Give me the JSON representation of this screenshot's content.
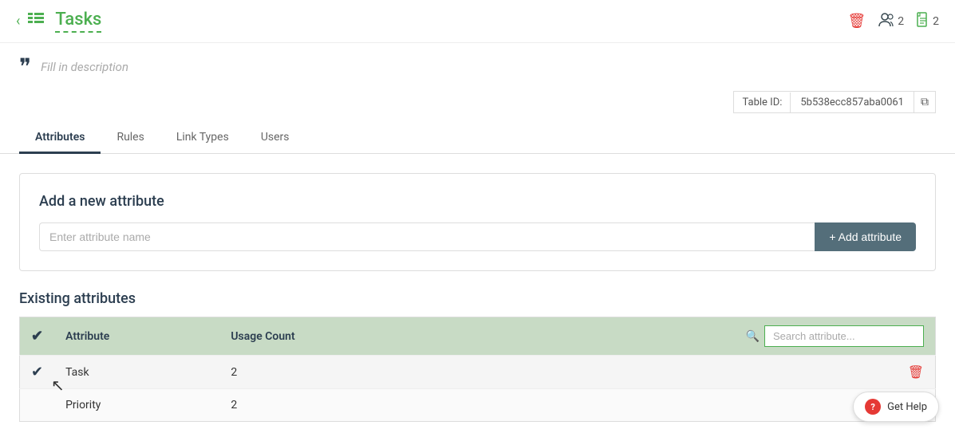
{
  "header": {
    "back_icon": "‹",
    "list_icon": "≡",
    "title": "Tasks",
    "delete_icon": "🗑",
    "users_count": "2",
    "docs_count": "2"
  },
  "description": {
    "placeholder": "Fill in description"
  },
  "table_id": {
    "label": "Table ID:",
    "value": "5b538ecc857aba0061",
    "copy_icon": "⧉"
  },
  "tabs": [
    {
      "label": "Attributes",
      "active": true
    },
    {
      "label": "Rules",
      "active": false
    },
    {
      "label": "Link Types",
      "active": false
    },
    {
      "label": "Users",
      "active": false
    }
  ],
  "add_attribute": {
    "title": "Add a new attribute",
    "input_placeholder": "Enter attribute name",
    "button_label": "+ Add attribute"
  },
  "existing_attributes": {
    "title": "Existing attributes",
    "search_placeholder": "Search attribute...",
    "columns": [
      "Attribute",
      "Usage Count"
    ],
    "rows": [
      {
        "name": "Task",
        "usage_count": "2",
        "checked": true
      },
      {
        "name": "Priority",
        "usage_count": "2",
        "checked": false
      }
    ]
  },
  "get_help": {
    "label": "Get Help"
  }
}
